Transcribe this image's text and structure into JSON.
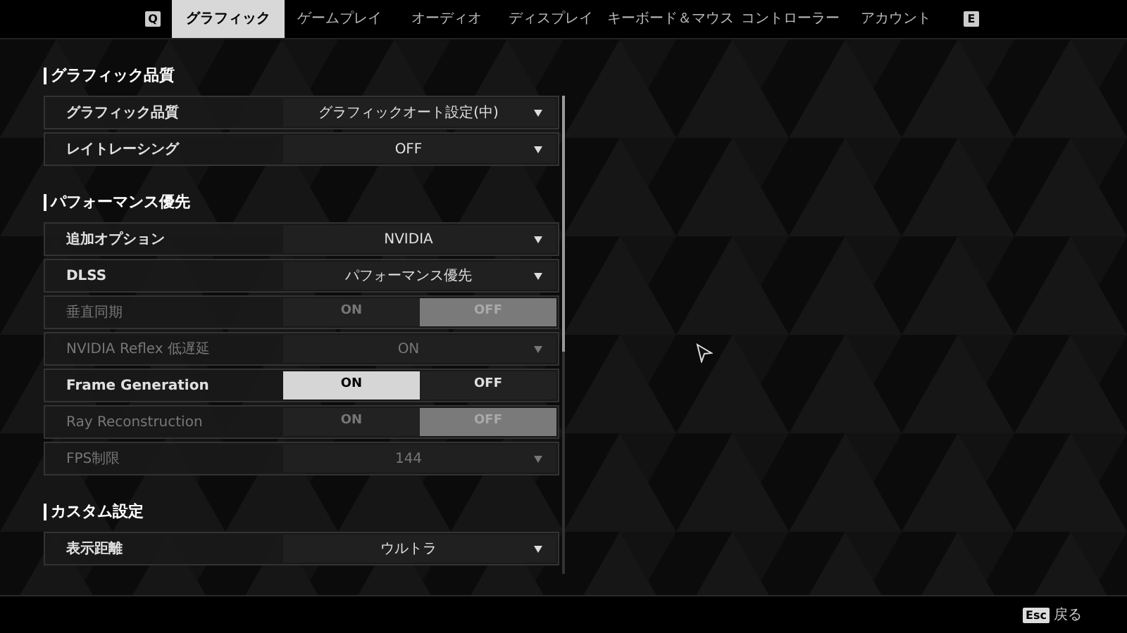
{
  "tabs": {
    "prev_key": "Q",
    "next_key": "E",
    "items": [
      {
        "label": "グラフィック",
        "selected": true
      },
      {
        "label": "ゲームプレイ",
        "selected": false
      },
      {
        "label": "オーディオ",
        "selected": false
      },
      {
        "label": "ディスプレイ",
        "selected": false
      },
      {
        "label": "キーボード＆マウス",
        "selected": false
      },
      {
        "label": "コントローラー",
        "selected": false
      },
      {
        "label": "アカウント",
        "selected": false
      }
    ]
  },
  "sections": [
    {
      "title": "グラフィック品質",
      "rows": [
        {
          "kind": "dropdown",
          "label": "グラフィック品質",
          "value": "グラフィックオート設定(中)",
          "disabled": false
        },
        {
          "kind": "dropdown",
          "label": "レイトレーシング",
          "value": "OFF",
          "disabled": false
        }
      ]
    },
    {
      "title": "パフォーマンス優先",
      "rows": [
        {
          "kind": "dropdown",
          "label": "追加オプション",
          "value": "NVIDIA",
          "disabled": false
        },
        {
          "kind": "dropdown",
          "label": "DLSS",
          "value": "パフォーマンス優先",
          "disabled": false
        },
        {
          "kind": "toggle",
          "label": "垂直同期",
          "disabled": true,
          "options": [
            {
              "label": "ON",
              "selected": false
            },
            {
              "label": "OFF",
              "selected": true
            }
          ]
        },
        {
          "kind": "dropdown",
          "label": "NVIDIA Reflex 低遅延",
          "value": "ON",
          "disabled": true
        },
        {
          "kind": "toggle",
          "label": "Frame Generation",
          "disabled": false,
          "options": [
            {
              "label": "ON",
              "selected": true
            },
            {
              "label": "OFF",
              "selected": false
            }
          ]
        },
        {
          "kind": "toggle",
          "label": "Ray Reconstruction",
          "disabled": true,
          "options": [
            {
              "label": "ON",
              "selected": false
            },
            {
              "label": "OFF",
              "selected": true
            }
          ]
        },
        {
          "kind": "dropdown",
          "label": "FPS制限",
          "value": "144",
          "disabled": true
        }
      ]
    },
    {
      "title": "カスタム設定",
      "rows": [
        {
          "kind": "dropdown",
          "label": "表示距離",
          "value": "ウルトラ",
          "disabled": false
        }
      ]
    }
  ],
  "footer": {
    "key": "Esc",
    "label": "戻る"
  }
}
